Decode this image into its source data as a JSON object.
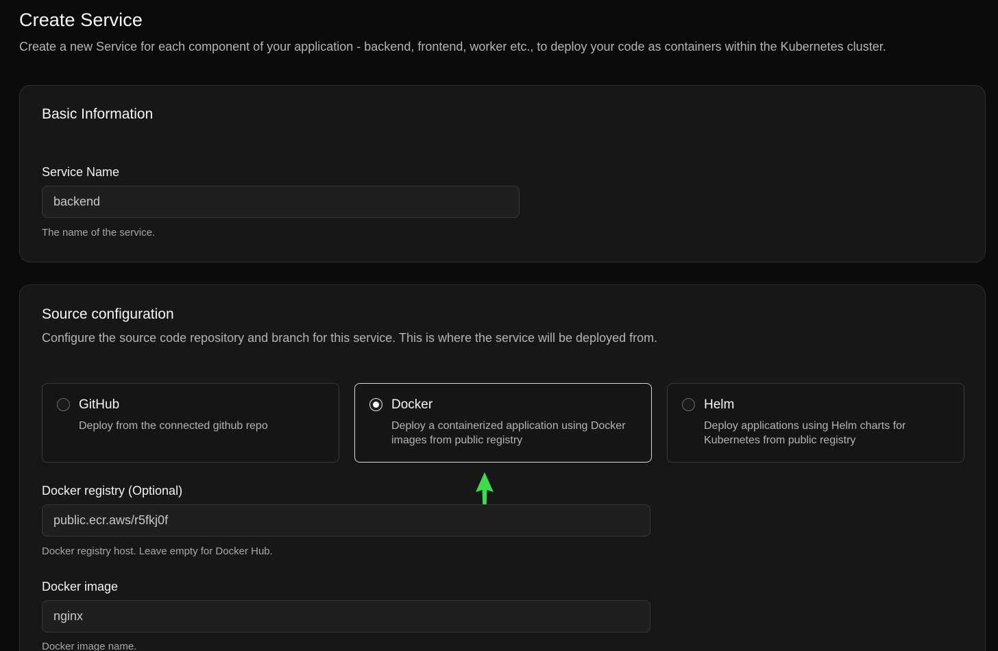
{
  "header": {
    "title": "Create Service",
    "subtitle": "Create a new Service for each component of your application - backend, frontend, worker etc., to deploy your code as containers within the Kubernetes cluster."
  },
  "basic_info": {
    "title": "Basic Information",
    "service_name": {
      "label": "Service Name",
      "value": "backend",
      "help": "The name of the service."
    }
  },
  "source": {
    "title": "Source configuration",
    "description": "Configure the source code repository and branch for this service. This is where the service will be deployed from.",
    "selected": "docker",
    "options": [
      {
        "id": "github",
        "title": "GitHub",
        "description": "Deploy from the connected github repo"
      },
      {
        "id": "docker",
        "title": "Docker",
        "description": "Deploy a containerized application using Docker images from public registry"
      },
      {
        "id": "helm",
        "title": "Helm",
        "description": "Deploy applications using Helm charts for Kubernetes from public registry"
      }
    ],
    "docker_registry": {
      "label": "Docker registry (Optional)",
      "value": "public.ecr.aws/r5fkj0f",
      "help": "Docker registry host. Leave empty for Docker Hub."
    },
    "docker_image": {
      "label": "Docker image",
      "value": "nginx",
      "help": "Docker image name."
    }
  },
  "annotation": {
    "arrow_color": "#3ddc4e"
  },
  "colors": {
    "background": "#0b0b0c",
    "card": "#171717",
    "border": "#2e2e2e",
    "selected_border": "#d9d9d9"
  }
}
